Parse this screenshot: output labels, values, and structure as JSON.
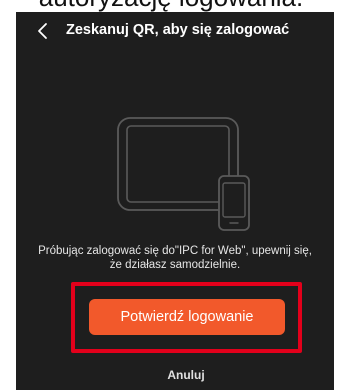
{
  "top_caption": "autoryzację logowania.",
  "header": {
    "title": "Zeskanuj QR, aby się zalogować",
    "back_icon": "chevron-left-icon"
  },
  "illustration": {
    "icons": [
      "tablet-icon",
      "phone-icon"
    ]
  },
  "message": {
    "line1": "Próbując zalogować się do\"IPC for Web\", upewnij się,",
    "line2": "że działasz samodzielnie."
  },
  "actions": {
    "confirm_label": "Potwierdź logowanie",
    "cancel_label": "Anuluj"
  },
  "colors": {
    "background": "#1e1e1e",
    "accent": "#f2592b",
    "highlight": "#e3001b"
  }
}
